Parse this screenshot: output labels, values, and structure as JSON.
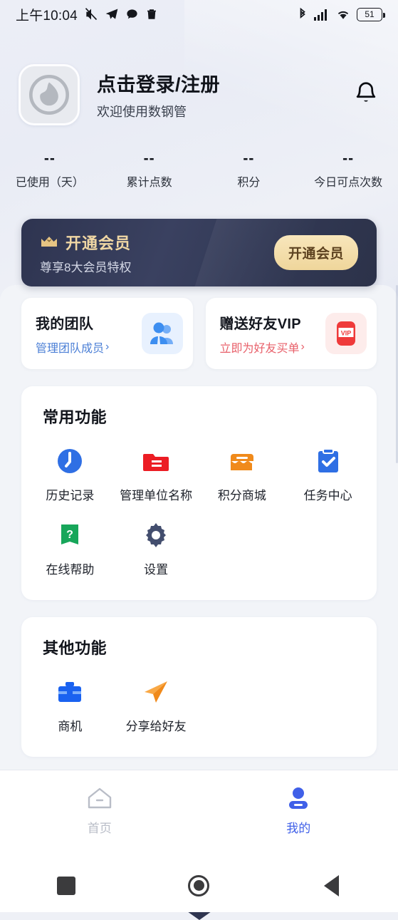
{
  "status_bar": {
    "time": "上午10:04",
    "left_icons": [
      "mute-icon",
      "telegram-icon",
      "message-icon",
      "trash-icon"
    ],
    "right_icons": [
      "bluetooth-icon",
      "signal-icon",
      "wifi-icon"
    ],
    "battery_level": "51"
  },
  "profile": {
    "title": "点击登录/注册",
    "subtitle": "欢迎使用数钢管",
    "avatar_icon": "default-avatar-icon",
    "notification_icon": "bell-icon"
  },
  "stats": [
    {
      "value": "--",
      "label": "已使用（天）"
    },
    {
      "value": "--",
      "label": "累计点数"
    },
    {
      "value": "--",
      "label": "积分"
    },
    {
      "value": "--",
      "label": "今日可点次数"
    }
  ],
  "vip_banner": {
    "icon": "crown-icon",
    "title": "开通会员",
    "subtitle": "尊享8大会员特权",
    "button_label": "开通会员",
    "bg_color": "#333a57",
    "accent_color": "#f0d7a4"
  },
  "promos": [
    {
      "title": "我的团队",
      "link": "管理团队成员",
      "chevron": "›",
      "icon": "team-people-icon",
      "icon_color": "#3d8ef0",
      "link_color": "#4b7fd6"
    },
    {
      "title": "赠送好友VIP",
      "link": "立即为好友买单",
      "chevron": "›",
      "icon": "vip-card-icon",
      "icon_label": "VIP",
      "icon_color": "#ef3a3a",
      "link_color": "#e8606a"
    }
  ],
  "sections": [
    {
      "title": "常用功能",
      "items": [
        {
          "label": "历史记录",
          "icon": "clock-icon",
          "color": "#2f6fe4"
        },
        {
          "label": "管理单位名称",
          "icon": "folder-icon",
          "color": "#ec1d24"
        },
        {
          "label": "积分商城",
          "icon": "shop-icon",
          "color": "#f08a1b"
        },
        {
          "label": "任务中心",
          "icon": "clipboard-check-icon",
          "color": "#2f6fe4"
        },
        {
          "label": "在线帮助",
          "icon": "help-book-icon",
          "color": "#17a65a"
        },
        {
          "label": "设置",
          "icon": "gear-icon",
          "color": "#434e6e"
        }
      ]
    },
    {
      "title": "其他功能",
      "items": [
        {
          "label": "商机",
          "icon": "briefcase-icon",
          "color": "#1a62f0"
        },
        {
          "label": "分享给好友",
          "icon": "paper-plane-icon",
          "color": "#f08a1b"
        }
      ]
    }
  ],
  "tab_bar": [
    {
      "label": "首页",
      "icon": "home-icon",
      "active": false,
      "color": "#b9bdc7"
    },
    {
      "label": "我的",
      "icon": "person-icon",
      "active": true,
      "color": "#4060e8"
    }
  ],
  "nav_bar": [
    {
      "icon": "recents-square-icon"
    },
    {
      "icon": "home-circle-icon"
    },
    {
      "icon": "back-triangle-icon"
    }
  ]
}
